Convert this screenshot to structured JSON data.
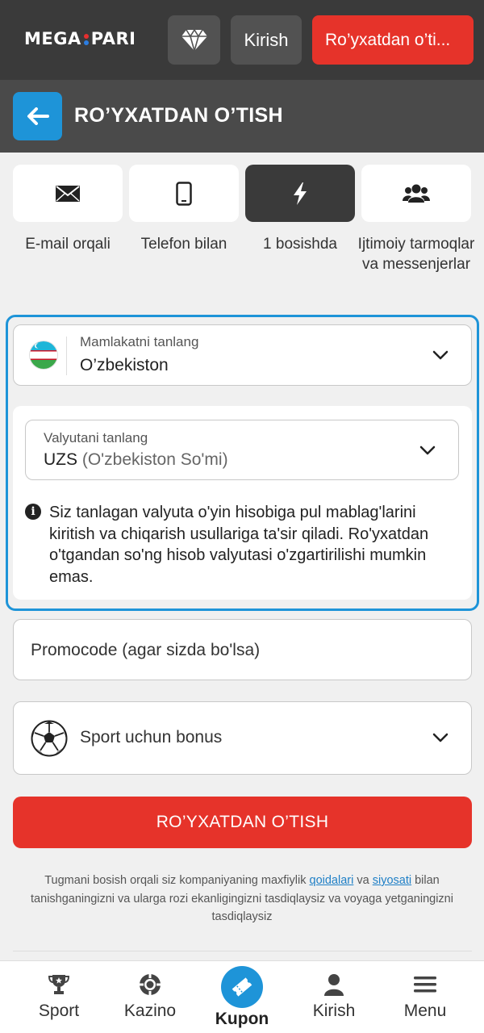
{
  "header": {
    "logo_left": "MEGA",
    "logo_right": "PARI",
    "diamond_icon": "diamond-icon",
    "login_label": "Kirish",
    "register_label": "Ro’yxatdan o’ti..."
  },
  "titlebar": {
    "back_icon": "arrow-left-icon",
    "title": "RO’YXATDAN O’TISH"
  },
  "methods": [
    {
      "label": "E-mail orqali",
      "icon": "envelope-icon",
      "active": false
    },
    {
      "label": "Telefon bilan",
      "icon": "phone-icon",
      "active": false
    },
    {
      "label": "1 bosishda",
      "icon": "lightning-icon",
      "active": true
    },
    {
      "label": "Ijtimoiy tarmoqlar va messenjerlar",
      "icon": "users-icon",
      "active": false
    }
  ],
  "country": {
    "label": "Mamlakatni tanlang",
    "value": "O’zbekiston"
  },
  "currency": {
    "label": "Valyutani tanlang",
    "code": "UZS",
    "name": "(O'zbekiston So'mi)",
    "info": "Siz tanlagan valyuta o'yin hisobiga pul mablag'larini kiritish va chiqarish usullariga ta'sir qiladi. Ro'yxatdan o'tgandan so'ng hisob valyutasi o'zgartirilishi mumkin emas."
  },
  "promo": {
    "placeholder": "Promocode (agar sizda bo'lsa)"
  },
  "bonus": {
    "label": "Sport uchun bonus"
  },
  "register_button": "RO’YXATDAN O’TISH",
  "terms": {
    "before": "Tugmani bosish orqali siz kompaniyaning maxfiylik ",
    "link1": "qoidalari",
    "middle": " va ",
    "link2": "siyosati",
    "after": " bilan tanishganingizni va ularga rozi ekanligingizni tasdiqlaysiz va voyaga yetganingizni tasdiqlaysiz"
  },
  "bottom_nav": [
    {
      "label": "Sport",
      "icon": "trophy-icon"
    },
    {
      "label": "Kazino",
      "icon": "casino-chip-icon"
    },
    {
      "label": "Kupon",
      "icon": "ticket-icon",
      "active": true
    },
    {
      "label": "Kirish",
      "icon": "user-icon"
    },
    {
      "label": "Menu",
      "icon": "hamburger-icon"
    }
  ],
  "colors": {
    "brand_red": "#e6332a",
    "accent_blue": "#1e94d8",
    "header_dark": "#3a3a3a"
  }
}
